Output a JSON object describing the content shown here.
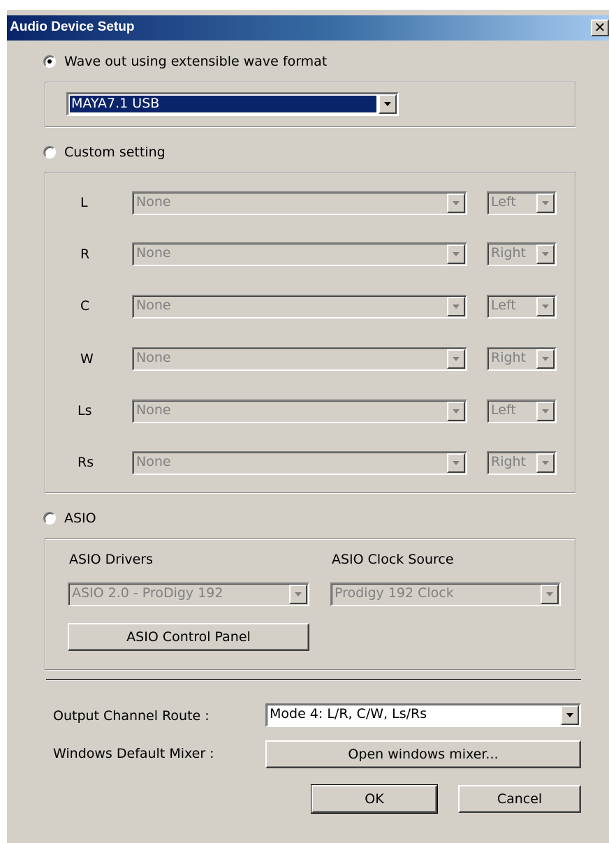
{
  "window": {
    "title": "Audio Device Setup",
    "close_glyph": "✕"
  },
  "wave_out": {
    "radio_label": "Wave out using extensible wave format",
    "checked": true,
    "device_value": "MAYA7.1 USB"
  },
  "custom": {
    "radio_label": "Custom setting",
    "checked": false,
    "channels": [
      {
        "label": "L",
        "device": "None",
        "side": "Left"
      },
      {
        "label": "R",
        "device": "None",
        "side": "Right"
      },
      {
        "label": "C",
        "device": "None",
        "side": "Left"
      },
      {
        "label": "W",
        "device": "None",
        "side": "Right"
      },
      {
        "label": "Ls",
        "device": "None",
        "side": "Left"
      },
      {
        "label": "Rs",
        "device": "None",
        "side": "Right"
      }
    ]
  },
  "asio": {
    "radio_label": "ASIO",
    "checked": false,
    "drivers_label": "ASIO Drivers",
    "clock_label": "ASIO Clock Source",
    "driver_value": "ASIO 2.0 - ProDigy 192",
    "clock_value": "Prodigy 192 Clock",
    "control_panel_button": "ASIO Control Panel"
  },
  "output": {
    "route_label": "Output Channel Route :",
    "route_value": "Mode 4: L/R, C/W, Ls/Rs",
    "mixer_label": "Windows Default Mixer :",
    "mixer_button": "Open windows mixer..."
  },
  "footer": {
    "ok_label": "OK",
    "cancel_label": "Cancel"
  },
  "colors": {
    "face": "#d4d0c8",
    "title_start": "#0a246a",
    "title_end": "#a6caf0",
    "selection": "#0a246a",
    "disabled_text": "#808080"
  }
}
